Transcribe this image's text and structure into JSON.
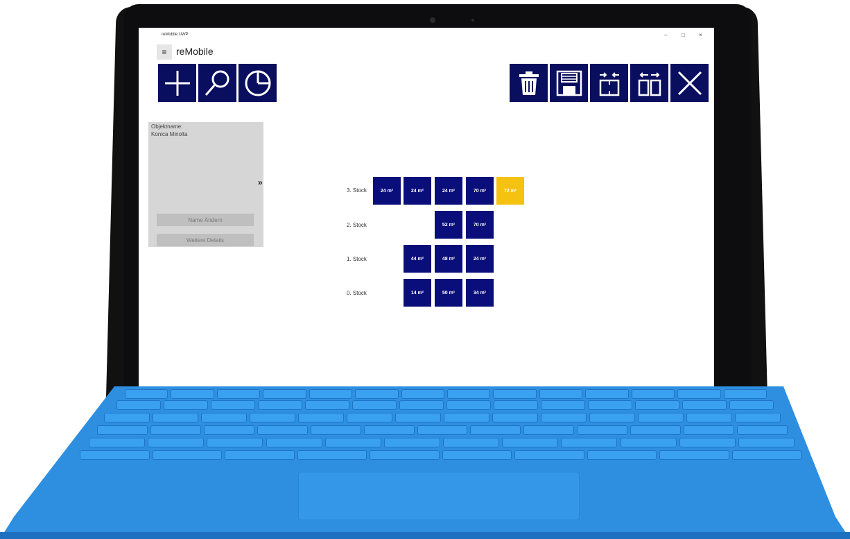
{
  "window": {
    "title": "reMobile.UWP",
    "minimize": "–",
    "maximize": "□",
    "close": "×"
  },
  "app": {
    "name": "reMobile"
  },
  "toolbar_left": [
    {
      "icon": "plus-icon"
    },
    {
      "icon": "search-icon"
    },
    {
      "icon": "pie-chart-icon"
    }
  ],
  "toolbar_right": [
    {
      "icon": "trash-icon"
    },
    {
      "icon": "save-icon"
    },
    {
      "icon": "merge-icon"
    },
    {
      "icon": "split-icon"
    },
    {
      "icon": "close-icon"
    }
  ],
  "object_panel": {
    "label": "Objektname:",
    "value": "Konica Minolta",
    "expand_glyph": "»",
    "rename_button": "Name Ändern",
    "details_button": "Weitere Details"
  },
  "floors": [
    {
      "label": "3. Stock",
      "units": [
        "24 m²",
        "24 m²",
        "24 m²",
        "70 m²",
        "72 m²"
      ]
    },
    {
      "label": "2. Stock",
      "units": [
        "52 m²",
        "70 m²"
      ]
    },
    {
      "label": "1. Stock",
      "units": [
        "44 m²",
        "48 m²",
        "24 m²"
      ]
    },
    {
      "label": "0. Stock",
      "units": [
        "14 m²",
        "50 m²",
        "34 m²"
      ]
    }
  ],
  "colors": {
    "tile": "#0a0e5e",
    "unit": "#0a0e7a",
    "selected_unit": "#f5c211",
    "keyboard": "#2e8fe0"
  }
}
